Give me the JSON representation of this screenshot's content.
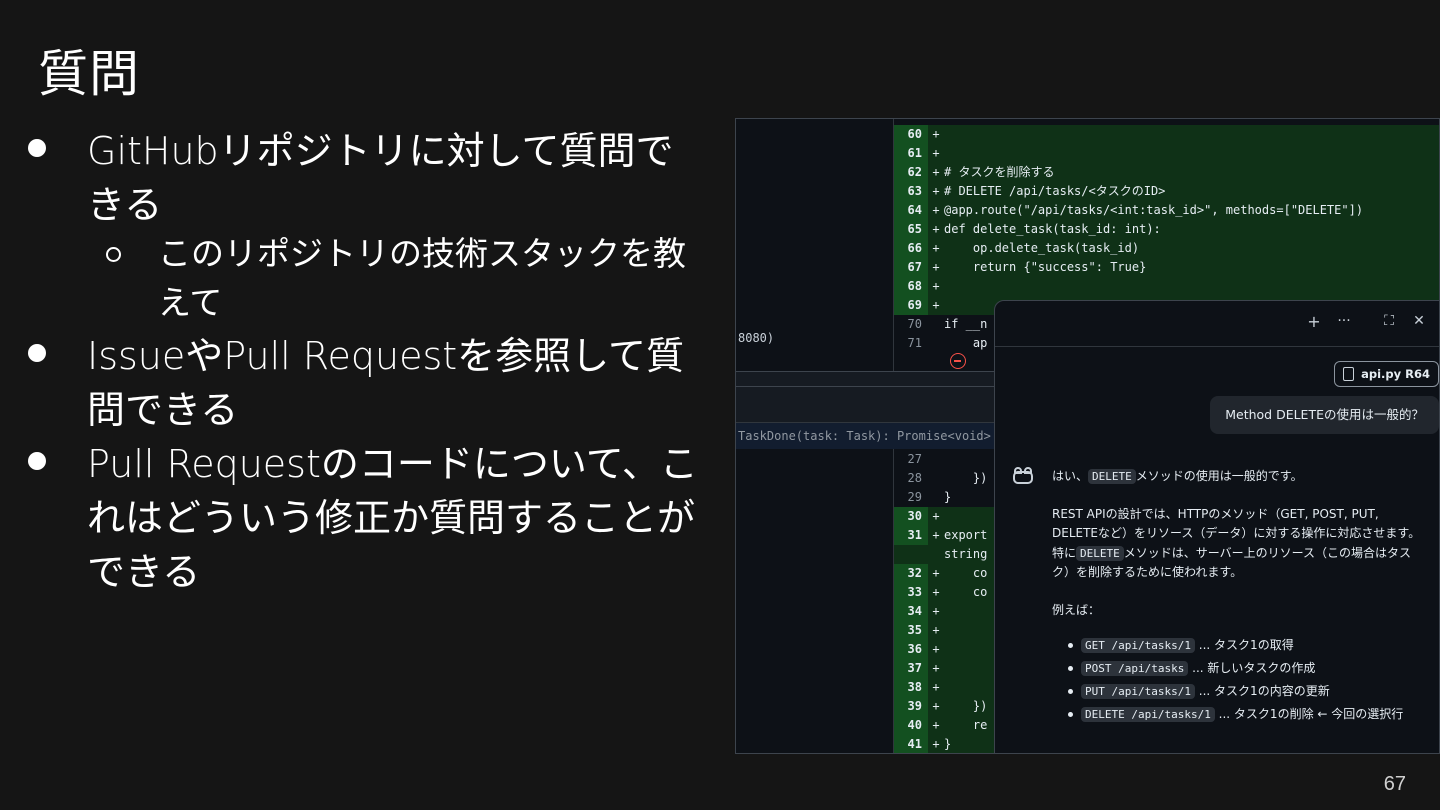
{
  "slide": {
    "title": "質問",
    "page_number": "67",
    "bullets": [
      {
        "text": "GitHubリポジトリに対して質問できる",
        "sub": [
          "このリポジトリの技術スタックを教えて"
        ]
      },
      {
        "text": "IssueやPull Requestを参照して質問できる",
        "sub": []
      },
      {
        "text": "Pull Requestのコードについて、これはどういう修正か質問することができる",
        "sub": []
      }
    ]
  },
  "diff_top": {
    "left_fragment": "8080)",
    "rows": [
      {
        "ln": "60",
        "sign": "+",
        "code": ""
      },
      {
        "ln": "61",
        "sign": "+",
        "code": ""
      },
      {
        "ln": "62",
        "sign": "+",
        "code": "# タスクを削除する"
      },
      {
        "ln": "63",
        "sign": "+",
        "code": "# DELETE /api/tasks/<タスクのID>"
      },
      {
        "ln": "64",
        "sign": "+",
        "code_a": "@app.route(",
        "code_b": "\"/api/tasks/<int:task_id>\"",
        "code_c": ", methods=[",
        "code_d": "\"DELETE\"",
        "code_e": "])"
      },
      {
        "ln": "65",
        "sign": "+",
        "code_kw": "def",
        "code_fn": "delete_task",
        "code_rest": "(task_id: int):"
      },
      {
        "ln": "66",
        "sign": "+",
        "code": "    op.delete_task(task_id)"
      },
      {
        "ln": "67",
        "sign": "+",
        "code_kw": "    return",
        "code_rest": " {",
        "code_st": "\"success\"",
        "code_rest2": ": ",
        "code_bl": "True",
        "code_rest3": "}"
      },
      {
        "ln": "68",
        "sign": "+",
        "code": ""
      },
      {
        "ln": "69",
        "sign": "+",
        "code": ""
      },
      {
        "ln": "70",
        "sign": "",
        "code": "if __n"
      },
      {
        "ln": "71",
        "sign": "",
        "code": "    ap"
      }
    ]
  },
  "diff_bottom": {
    "hunk_header": "TaskDone(task: Task): Promise<void> {",
    "rows": [
      {
        "ln": "27",
        "sign": "",
        "code": ""
      },
      {
        "ln": "28",
        "sign": "",
        "code": "    })"
      },
      {
        "ln": "29",
        "sign": "",
        "code": "}"
      },
      {
        "ln": "30",
        "sign": "+",
        "code": ""
      },
      {
        "ln": "31",
        "sign": "+",
        "code": "export"
      },
      {
        "ln": "",
        "sign": "",
        "code": "string"
      },
      {
        "ln": "32",
        "sign": "+",
        "code": "    co"
      },
      {
        "ln": "33",
        "sign": "+",
        "code": "    co"
      },
      {
        "ln": "34",
        "sign": "+",
        "code": ""
      },
      {
        "ln": "35",
        "sign": "+",
        "code": ""
      },
      {
        "ln": "36",
        "sign": "+",
        "code": ""
      },
      {
        "ln": "37",
        "sign": "+",
        "code": ""
      },
      {
        "ln": "38",
        "sign": "+",
        "code": ""
      },
      {
        "ln": "39",
        "sign": "+",
        "code": "    })"
      },
      {
        "ln": "40",
        "sign": "+",
        "code": "    re"
      },
      {
        "ln": "41",
        "sign": "+",
        "code": "}"
      }
    ]
  },
  "chat": {
    "toolbar": {
      "plus": "+",
      "more": "···",
      "expand": "⛶",
      "close": "✕"
    },
    "reference_chip": "api.py R64",
    "user_message": "Method DELETEの使用は一般的？",
    "answer": {
      "p1_a": "はい、",
      "p1_code": "DELETE",
      "p1_b": "メソッドの使用は一般的です。",
      "p2": "REST APIの設計では、HTTPのメソッド（GET, POST, PUT, DELETEなど）をリソース（データ）に対する操作に対応させます。",
      "p3_a": "特に",
      "p3_code": "DELETE",
      "p3_b": "メソッドは、サーバー上のリソース（この場合はタスク）を削除するために使われます。",
      "p4": "例えば：",
      "items": [
        {
          "code": "GET /api/tasks/1",
          "text": "... タスク1の取得"
        },
        {
          "code": "POST /api/tasks",
          "text": "... 新しいタスクの作成"
        },
        {
          "code": "PUT /api/tasks/1",
          "text": "... タスク1の内容の更新"
        },
        {
          "code": "DELETE /api/tasks/1",
          "text": "... タスク1の削除 ← 今回の選択行"
        }
      ]
    }
  },
  "colors": {
    "background": "#151515",
    "diff_add_bg": "#0f3117",
    "diff_add_gutter": "#135020",
    "accent_blue": "#4493f8",
    "delete_marker": "#f85149"
  }
}
